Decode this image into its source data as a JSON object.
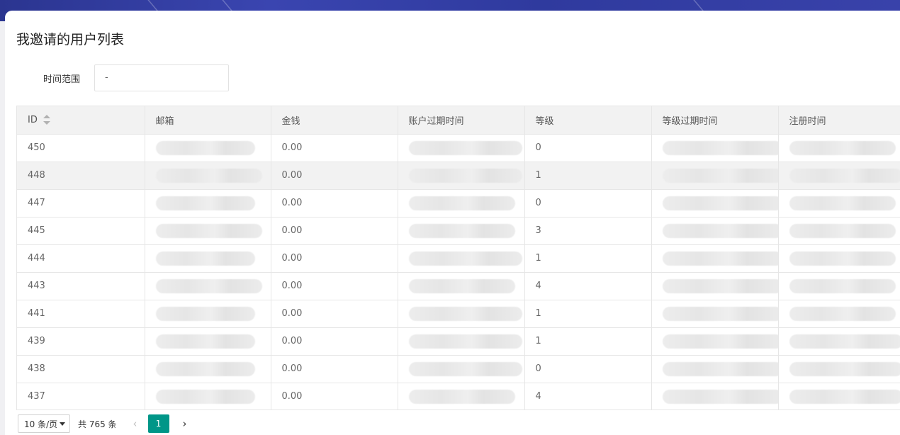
{
  "page": {
    "title": "我邀请的用户列表"
  },
  "filter": {
    "label": "时间范围",
    "value": "-"
  },
  "table": {
    "columns": [
      "ID",
      "邮箱",
      "金钱",
      "账户过期时间",
      "等级",
      "等级过期时间",
      "注册时间"
    ],
    "rows": [
      {
        "id": "450",
        "money": "0.00",
        "level": "0"
      },
      {
        "id": "448",
        "money": "0.00",
        "level": "1"
      },
      {
        "id": "447",
        "money": "0.00",
        "level": "0"
      },
      {
        "id": "445",
        "money": "0.00",
        "level": "3"
      },
      {
        "id": "444",
        "money": "0.00",
        "level": "1"
      },
      {
        "id": "443",
        "money": "0.00",
        "level": "4"
      },
      {
        "id": "441",
        "money": "0.00",
        "level": "1"
      },
      {
        "id": "439",
        "money": "0.00",
        "level": "1"
      },
      {
        "id": "438",
        "money": "0.00",
        "level": "0"
      },
      {
        "id": "437",
        "money": "0.00",
        "level": "4"
      }
    ]
  },
  "pagination": {
    "page_size": "10 条/页",
    "total": "共 765 条",
    "current_page": "1",
    "prev_icon": "chevron-left-icon",
    "next_icon": "chevron-right-icon"
  },
  "colors": {
    "header_bar": "#2f3a9e",
    "accent": "#009688"
  }
}
